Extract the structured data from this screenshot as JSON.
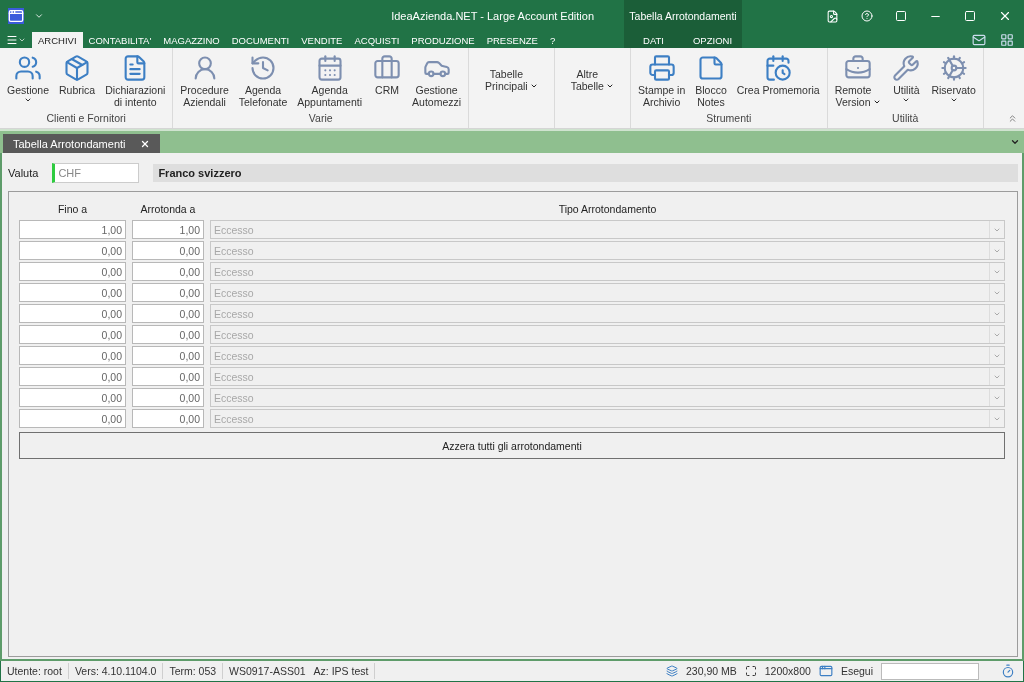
{
  "window": {
    "title": "IdeaAzienda.NET - Large Account Edition",
    "context_title": "Tabella Arrotondamenti"
  },
  "ribbon_tabs": [
    {
      "label": "ARCHIVI",
      "selected": true
    },
    {
      "label": "CONTABILITA'",
      "selected": false
    },
    {
      "label": "MAGAZZINO",
      "selected": false
    },
    {
      "label": "DOCUMENTI",
      "selected": false
    },
    {
      "label": "VENDITE",
      "selected": false
    },
    {
      "label": "ACQUISTI",
      "selected": false
    },
    {
      "label": "PRODUZIONE",
      "selected": false
    },
    {
      "label": "PRESENZE",
      "selected": false
    },
    {
      "label": "?",
      "selected": false
    }
  ],
  "context_tabs": [
    {
      "label": "DATI",
      "selected": false
    },
    {
      "label": "OPZIONI",
      "selected": false
    }
  ],
  "ribbon_groups": [
    {
      "label": "Clienti e Fornitori",
      "items": [
        {
          "lines": [
            "Gestione"
          ],
          "dropdown": true
        },
        {
          "lines": [
            "Rubrica"
          ],
          "dropdown": false
        },
        {
          "lines": [
            "Dichiarazioni",
            "di intento"
          ],
          "dropdown": false
        }
      ]
    },
    {
      "label": "Varie",
      "items": [
        {
          "lines": [
            "Procedure",
            "Aziendali"
          ],
          "dropdown": false
        },
        {
          "lines": [
            "Agenda",
            "Telefonate"
          ],
          "dropdown": false
        },
        {
          "lines": [
            "Agenda",
            "Appuntamenti"
          ],
          "dropdown": false
        },
        {
          "lines": [
            "CRM"
          ],
          "dropdown": false
        },
        {
          "lines": [
            "Gestione",
            "Automezzi"
          ],
          "dropdown": false
        }
      ]
    },
    {
      "items": [
        {
          "lines": [
            "Tabelle",
            "Principali"
          ],
          "dropdown": true
        }
      ]
    },
    {
      "items": [
        {
          "lines": [
            "Altre",
            "Tabelle"
          ],
          "dropdown": true
        }
      ]
    },
    {
      "label": "Strumenti",
      "items": [
        {
          "lines": [
            "Stampe in",
            "Archivio"
          ],
          "dropdown": false
        },
        {
          "lines": [
            "Blocco",
            "Notes"
          ],
          "dropdown": false
        },
        {
          "lines": [
            "Crea Promemoria"
          ],
          "dropdown": false
        }
      ]
    },
    {
      "label": "Utilità",
      "items": [
        {
          "lines": [
            "Remote",
            "Version"
          ],
          "dropdown": true
        },
        {
          "lines": [
            "Utilità"
          ],
          "dropdown": true
        },
        {
          "lines": [
            "Riservato"
          ],
          "dropdown": true
        }
      ]
    }
  ],
  "document_tabs": [
    {
      "label": "Tabella Arrotondamenti",
      "selected": true
    }
  ],
  "form": {
    "currency_label": "Valuta",
    "currency_code": "CHF",
    "currency_name": "Franco svizzero",
    "columns": [
      "Fino a",
      "Arrotonda a",
      "Tipo Arrotondamento"
    ],
    "rows": [
      {
        "up_to": "1,00",
        "round_to": "1,00",
        "type": "Eccesso",
        "disabled": true
      },
      {
        "up_to": "0,00",
        "round_to": "0,00",
        "type": "Eccesso",
        "disabled": true
      },
      {
        "up_to": "0,00",
        "round_to": "0,00",
        "type": "Eccesso",
        "disabled": true
      },
      {
        "up_to": "0,00",
        "round_to": "0,00",
        "type": "Eccesso",
        "disabled": true
      },
      {
        "up_to": "0,00",
        "round_to": "0,00",
        "type": "Eccesso",
        "disabled": true
      },
      {
        "up_to": "0,00",
        "round_to": "0,00",
        "type": "Eccesso",
        "disabled": true
      },
      {
        "up_to": "0,00",
        "round_to": "0,00",
        "type": "Eccesso",
        "disabled": true
      },
      {
        "up_to": "0,00",
        "round_to": "0,00",
        "type": "Eccesso",
        "disabled": true
      },
      {
        "up_to": "0,00",
        "round_to": "0,00",
        "type": "Eccesso",
        "disabled": true
      },
      {
        "up_to": "0,00",
        "round_to": "0,00",
        "type": "Eccesso",
        "disabled": true
      }
    ],
    "reset_button": "Azzera tutti gli arrotondamenti"
  },
  "status_bar": {
    "cells": [
      [
        "Utente: root"
      ],
      [
        "Vers: 4.10.1104.0"
      ],
      [
        "Term: 053"
      ],
      [
        "WS0917-ASS01",
        "Az: IPS test"
      ]
    ],
    "memory": "230,90 MB",
    "resolution": "1200x800",
    "run_label": "Esegui"
  }
}
